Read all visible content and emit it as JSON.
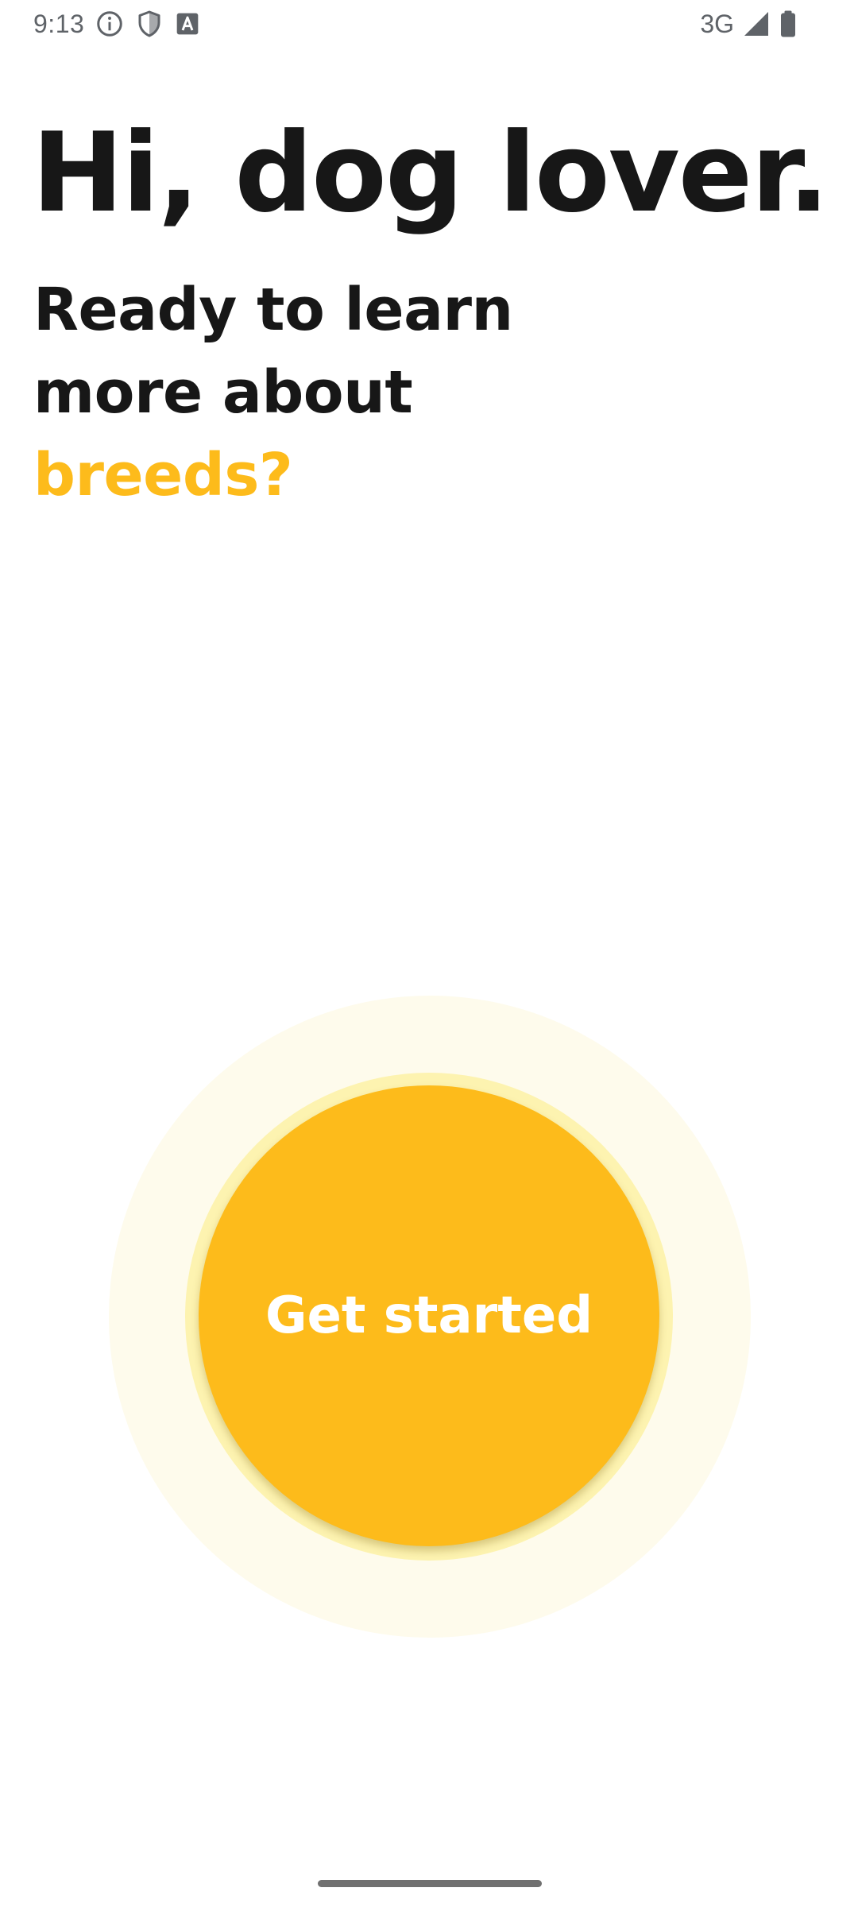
{
  "status_bar": {
    "time": "9:13",
    "network": "3G",
    "left_icons": [
      "info-icon",
      "shield-icon",
      "text-a-icon"
    ],
    "right_icons": [
      "signal-icon",
      "battery-icon"
    ]
  },
  "onboarding": {
    "greeting": "Hi, dog lover.",
    "question_line_1": "Ready to learn",
    "question_line_2": "more about",
    "question_accent": "breeds?",
    "accent_color": "#fdbb1b",
    "text_color": "#171717"
  },
  "actions": {
    "get_started_label": "Get started",
    "button_color": "#fdbb1b"
  }
}
